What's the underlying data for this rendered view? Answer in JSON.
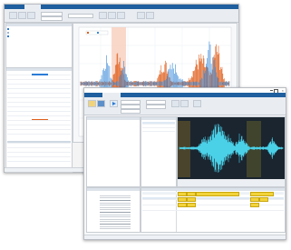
{
  "back_window": {
    "tabs": [
      "",
      "",
      "",
      ""
    ],
    "status_text": ""
  },
  "front_window": {
    "title": "",
    "tabs": [
      "",
      "",
      ""
    ],
    "files": [
      "",
      "",
      "",
      ""
    ],
    "waveform_panel_title": "",
    "label_panel_title": "",
    "label_rows": [
      "",
      "",
      "",
      ""
    ],
    "info_lines": [
      "",
      "",
      "",
      "",
      "",
      ""
    ],
    "status_text": ""
  },
  "colors": {
    "ribbon_blue": "#1f5f9f",
    "signal_blue": "#3a8ad8",
    "signal_orange": "#e0601e",
    "roi_highlight": "#f7c7b3",
    "label_yellow": "#f2d33b",
    "dark_plot_bg": "#1a2530",
    "teal_signal": "#4ad1e8"
  },
  "icons": [
    "play-icon",
    "stop-icon",
    "zoom-icon",
    "open-folder-icon",
    "save-icon"
  ]
}
